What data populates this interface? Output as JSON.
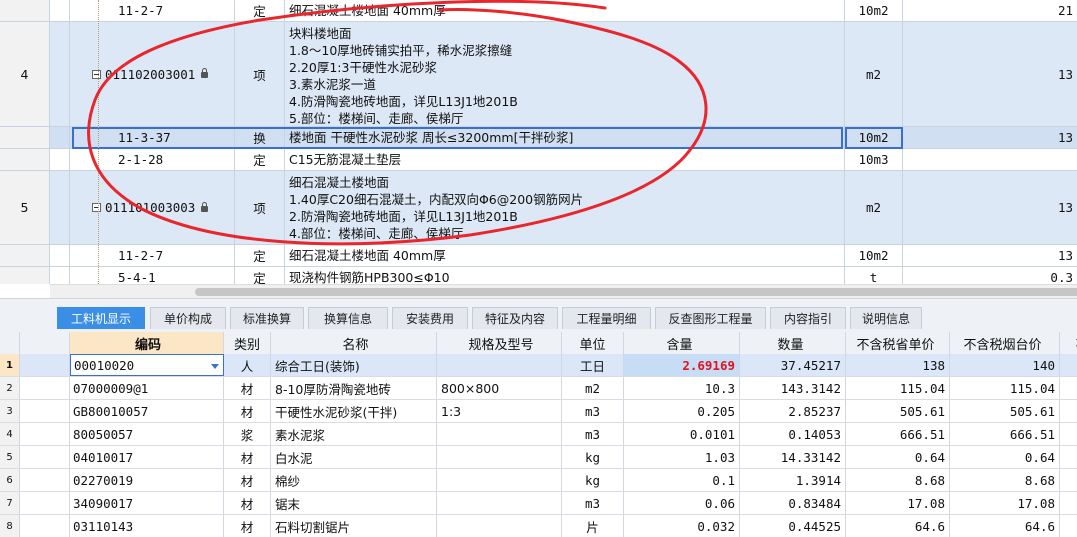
{
  "upper_rows": [
    {
      "num": "",
      "code": "11-2-7",
      "type": "定",
      "lines": [
        "细石混凝土楼地面 40mm厚"
      ],
      "unit": "10m2",
      "qty": "21",
      "style": "white"
    },
    {
      "num": "4",
      "code": "011102003001",
      "type": "项",
      "lines": [
        "块料楼地面",
        "1.8～10厚地砖铺实拍平，稀水泥浆擦缝",
        "2.20厚1:3干硬性水泥砂浆",
        "3.素水泥浆一道",
        "4.防滑陶瓷地砖地面，详见L13J1地201B",
        "5.部位：楼梯间、走廊、侯梯厅"
      ],
      "unit": "m2",
      "qty": "13",
      "style": "blue"
    },
    {
      "num": "",
      "code": "11-3-37",
      "type": "换",
      "lines": [
        "楼地面 干硬性水泥砂浆 周长≤3200mm[干拌砂浆]"
      ],
      "unit": "10m2",
      "qty": "13",
      "style": "sel"
    },
    {
      "num": "",
      "code": "2-1-28",
      "type": "定",
      "lines": [
        "C15无筋混凝土垫层"
      ],
      "unit": "10m3",
      "qty": "",
      "style": "white"
    },
    {
      "num": "5",
      "code": "011101003003",
      "type": "项",
      "lines": [
        "细石混凝土楼地面",
        "1.40厚C20细石混凝土，内配双向Φ6@200钢筋网片",
        "2.防滑陶瓷地砖地面，详见L13J1地201B",
        "4.部位：楼梯间、走廊、侯梯厅"
      ],
      "unit": "m2",
      "qty": "13",
      "style": "blue"
    },
    {
      "num": "",
      "code": "11-2-7",
      "type": "定",
      "lines": [
        "细石混凝土楼地面 40mm厚"
      ],
      "unit": "10m2",
      "qty": "13",
      "style": "white"
    },
    {
      "num": "",
      "code": "5-4-1",
      "type": "定",
      "lines": [
        "现浇构件钢筋HPB300≤Φ10"
      ],
      "unit": "t",
      "qty": "0.3",
      "style": "white"
    }
  ],
  "tabs": [
    "工料机显示",
    "单价构成",
    "标准换算",
    "换算信息",
    "安装费用",
    "特征及内容",
    "工程量明细",
    "反查图形工程量",
    "内容指引",
    "说明信息"
  ],
  "active_tab": 0,
  "lower_headers": {
    "code": "编码",
    "type": "类别",
    "name": "名称",
    "spec": "规格及型号",
    "unit": "单位",
    "qty": "含量",
    "cnt": "数量",
    "p1": "不含税省单价",
    "p2": "不含税烟台价",
    "p3": "不"
  },
  "lower_rows": [
    {
      "n": "1",
      "code": "00010020",
      "type": "人",
      "name": "综合工日(装饰)",
      "spec": "",
      "unit": "工日",
      "qty": "2.69169",
      "cnt": "37.45217",
      "p1": "138",
      "p2": "140"
    },
    {
      "n": "2",
      "code": "07000009@1",
      "type": "材",
      "name": "8-10厚防滑陶瓷地砖",
      "spec": "800×800",
      "unit": "m2",
      "qty": "10.3",
      "cnt": "143.3142",
      "p1": "115.04",
      "p2": "115.04"
    },
    {
      "n": "3",
      "code": "GB80010057",
      "type": "材",
      "name": "干硬性水泥砂浆(干拌)",
      "spec": "1:3",
      "unit": "m3",
      "qty": "0.205",
      "cnt": "2.85237",
      "p1": "505.61",
      "p2": "505.61"
    },
    {
      "n": "4",
      "code": "80050057",
      "type": "浆",
      "name": "素水泥浆",
      "spec": "",
      "unit": "m3",
      "qty": "0.0101",
      "cnt": "0.14053",
      "p1": "666.51",
      "p2": "666.51"
    },
    {
      "n": "5",
      "code": "04010017",
      "type": "材",
      "name": "白水泥",
      "spec": "",
      "unit": "kg",
      "qty": "1.03",
      "cnt": "14.33142",
      "p1": "0.64",
      "p2": "0.64"
    },
    {
      "n": "6",
      "code": "02270019",
      "type": "材",
      "name": "棉纱",
      "spec": "",
      "unit": "kg",
      "qty": "0.1",
      "cnt": "1.3914",
      "p1": "8.68",
      "p2": "8.68"
    },
    {
      "n": "7",
      "code": "34090017",
      "type": "材",
      "name": "锯末",
      "spec": "",
      "unit": "m3",
      "qty": "0.06",
      "cnt": "0.83484",
      "p1": "17.08",
      "p2": "17.08"
    },
    {
      "n": "8",
      "code": "03110143",
      "type": "材",
      "name": "石料切割锯片",
      "spec": "",
      "unit": "片",
      "qty": "0.032",
      "cnt": "0.44525",
      "p1": "64.6",
      "p2": "64.6"
    }
  ],
  "colors": {
    "accent": "#3a8ee6",
    "annotation": "#e8262c",
    "highlight": "#e0141e"
  }
}
